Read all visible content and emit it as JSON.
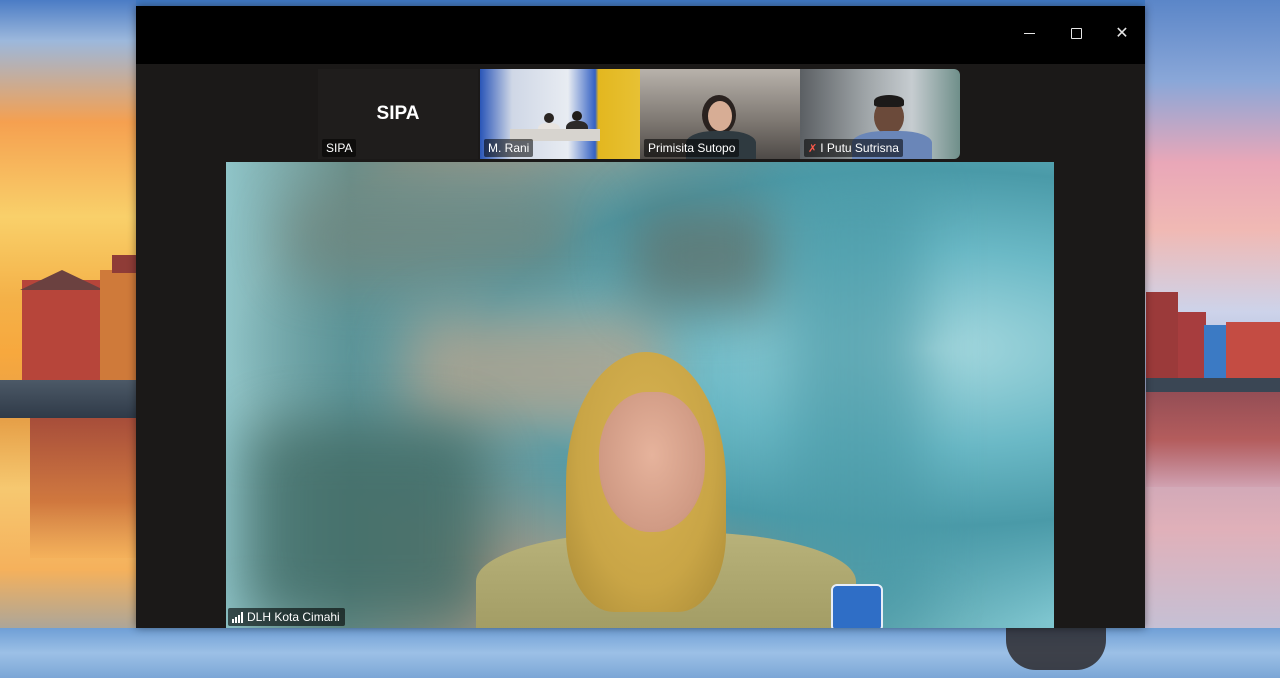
{
  "window": {
    "controls": {
      "minimize": "minimize",
      "maximize": "maximize",
      "close": "✕"
    }
  },
  "participants": [
    {
      "name": "SIPA",
      "display_name": "SIPA",
      "video": false,
      "muted": false
    },
    {
      "name": "M. Rani",
      "video": true,
      "muted": false
    },
    {
      "name": "Primisita Sutopo",
      "video": true,
      "muted": false
    },
    {
      "name": "I Putu Sutrisna",
      "video": true,
      "muted": true
    }
  ],
  "active_speaker": {
    "name": "DLH Kota Cimahi",
    "icon": "signal-strength-icon"
  },
  "icons": {
    "muted": "mic-off-icon",
    "signal": "signal-strength-icon"
  }
}
